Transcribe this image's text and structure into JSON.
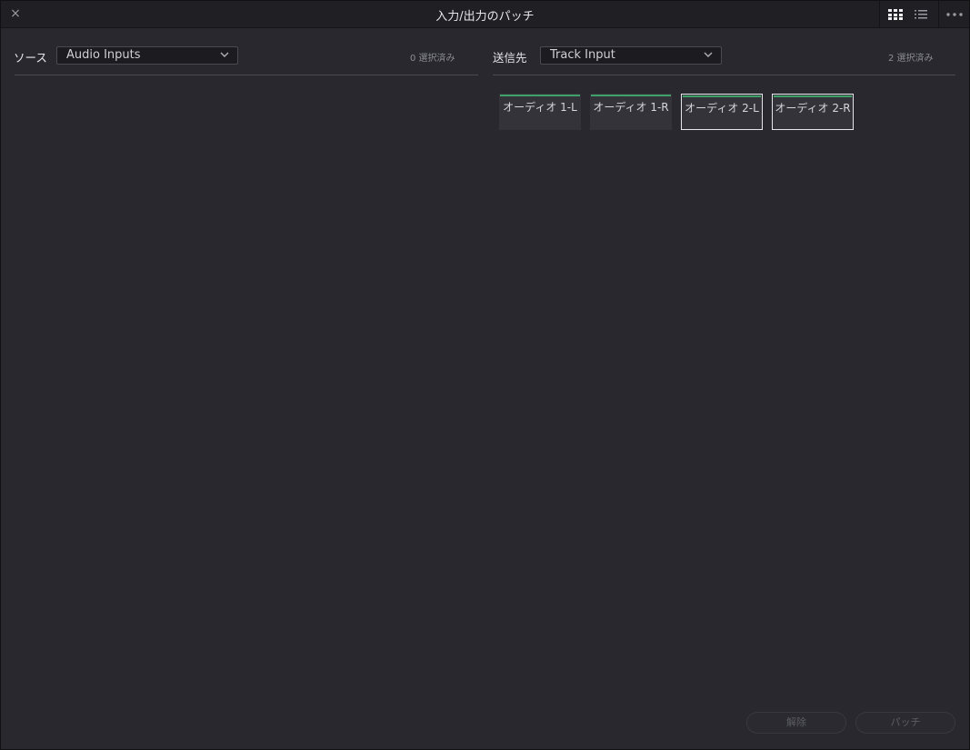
{
  "window": {
    "title": "入力/出力のパッチ",
    "close_icon": "×"
  },
  "toolbar": {
    "grid_view_icon": "grid-view-icon",
    "list_view_icon": "list-view-icon",
    "more_icon": "more-options-icon"
  },
  "source": {
    "label": "ソース",
    "dropdown_value": "Audio Inputs",
    "selected_count": "0 選択済み"
  },
  "destination": {
    "label": "送信先",
    "dropdown_value": "Track Input",
    "selected_count": "2 選択済み",
    "tiles": [
      {
        "label": "オーディオ 1-L",
        "selected": false
      },
      {
        "label": "オーディオ 1-R",
        "selected": false
      },
      {
        "label": "オーディオ 2-L",
        "selected": true
      },
      {
        "label": "オーディオ 2-R",
        "selected": true
      }
    ]
  },
  "footer": {
    "unpatch_label": "解除",
    "patch_label": "パッチ"
  },
  "colors": {
    "background": "#28282e",
    "titlebar": "#1f1f24",
    "tile_accent": "#3fa06a",
    "selected_border": "#e6e6ea"
  }
}
